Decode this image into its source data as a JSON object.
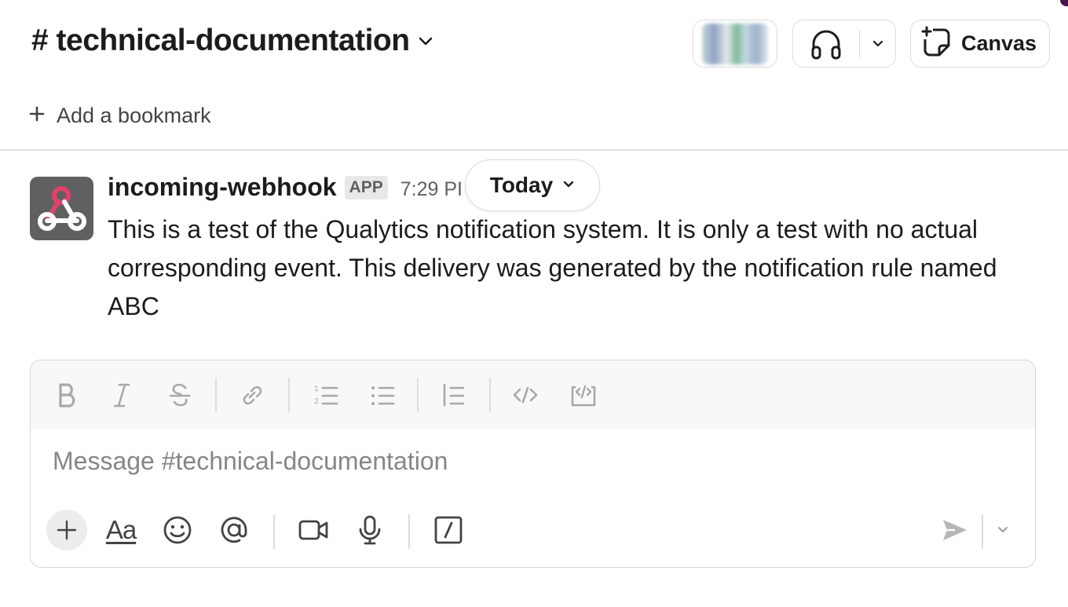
{
  "channel": {
    "name": "# technical-documentation"
  },
  "header": {
    "canvas_label": "Canvas",
    "bookmark_label": "Add a bookmark"
  },
  "message": {
    "sender": "incoming-webhook",
    "badge": "APP",
    "time": "7:29 PI",
    "text": "This is a test of the Qualytics notification system. It is only a test with no actual corresponding event. This delivery was generated by the notification rule named ABC"
  },
  "date_divider": {
    "label": "Today"
  },
  "composer": {
    "placeholder": "Message #technical-documentation",
    "format_label": "Aa"
  },
  "colors": {
    "accent": "#4a154b",
    "webhook_pink": "#e0426c",
    "text": "#1d1c1d",
    "muted": "#616061"
  },
  "icons": {
    "toolbar": [
      "bold-icon",
      "italic-icon",
      "strikethrough-icon",
      "link-icon",
      "ordered-list-icon",
      "bulleted-list-icon",
      "blockquote-icon",
      "code-icon",
      "code-block-icon"
    ],
    "bottom": [
      "plus-icon",
      "formatting-icon",
      "emoji-icon",
      "mention-icon",
      "video-icon",
      "microphone-icon",
      "slash-command-icon",
      "send-icon",
      "chevron-down-icon"
    ]
  }
}
